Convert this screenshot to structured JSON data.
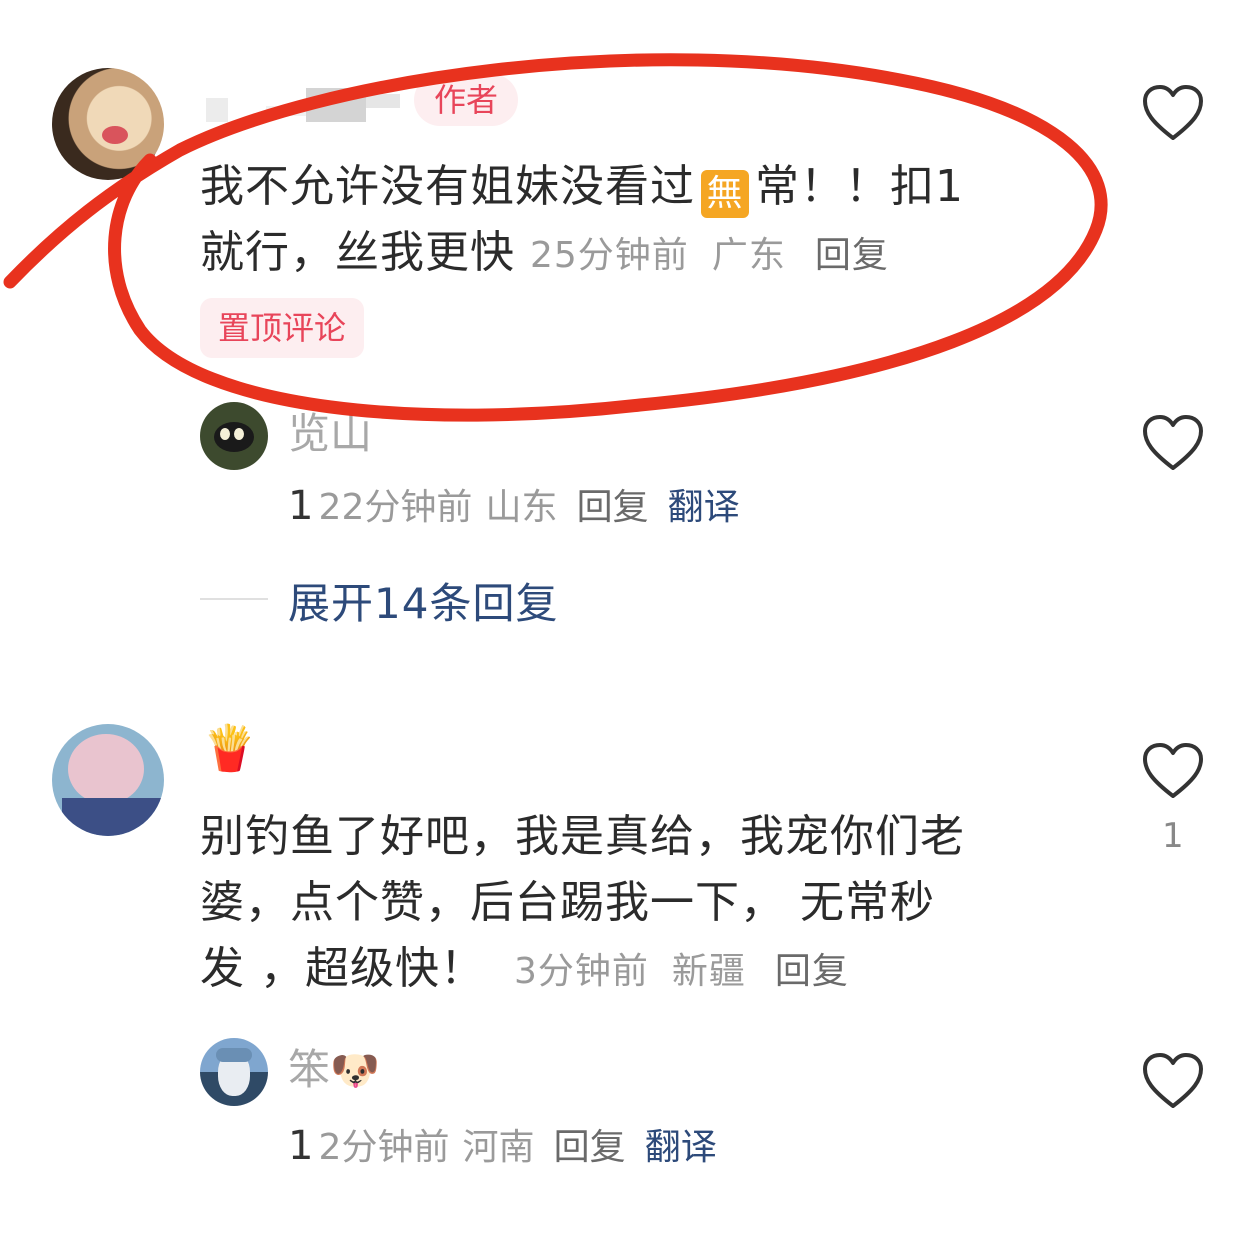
{
  "comments": [
    {
      "user": {
        "author_tag": "作者"
      },
      "text_line1_a": "我不允许没有姐妹没看过",
      "emoji_box": "無",
      "text_line1_b": "常！！扣1",
      "text_line2": "就行，丝我更快",
      "time": "25分钟前",
      "location": "广东",
      "reply_label": "回复",
      "pinned_tag": "置顶评论",
      "like_icon": "heart-outline-icon",
      "replies": [
        {
          "name": "览山",
          "count": "1",
          "time": "22分钟前",
          "location": "山东",
          "reply_label": "回复",
          "translate_label": "翻译"
        }
      ],
      "expand_label": "展开14条回复"
    },
    {
      "user": {
        "name_emoji": "🍟"
      },
      "text_line1": "别钓鱼了好吧，我是真给，我宠你们老",
      "text_line2": "婆，点个赞，后台踢我一下， 无常秒",
      "text_line3_a": "发 ，超级快！",
      "time": "3分钟前",
      "location": "新疆",
      "reply_label": "回复",
      "like_count": "1",
      "replies": [
        {
          "name": "笨",
          "name_emoji": "🐶",
          "count": "1",
          "time": "2分钟前",
          "location": "河南",
          "reply_label": "回复",
          "translate_label": "翻译"
        }
      ]
    }
  ],
  "colors": {
    "accent_link": "#2d4a7a",
    "tag_bg": "#fdeef0",
    "tag_text": "#e8455a",
    "annotation_red": "#e8321e"
  }
}
